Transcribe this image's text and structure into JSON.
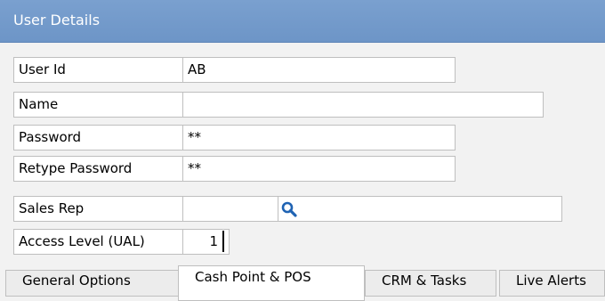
{
  "panel": {
    "title": "User Details"
  },
  "fields": {
    "user_id": {
      "label": "User Id",
      "value": "AB"
    },
    "name": {
      "label": "Name",
      "value": ""
    },
    "password": {
      "label": "Password",
      "value": "**"
    },
    "retype_password": {
      "label": "Retype Password",
      "value": "**"
    },
    "sales_rep": {
      "label": "Sales Rep",
      "value": "",
      "lookup_value": ""
    },
    "access_level": {
      "label": "Access Level (UAL)",
      "value": "1"
    }
  },
  "tabs": [
    {
      "label": "General Options",
      "active": false
    },
    {
      "label": "Cash Point & POS",
      "active": true
    },
    {
      "label": "CRM & Tasks",
      "active": false
    },
    {
      "label": "Live Alerts",
      "active": false
    }
  ],
  "colors": {
    "header": "#6d95c7",
    "icon": "#1f63b3"
  },
  "icons": {
    "sales_rep_lookup": "search-icon"
  }
}
